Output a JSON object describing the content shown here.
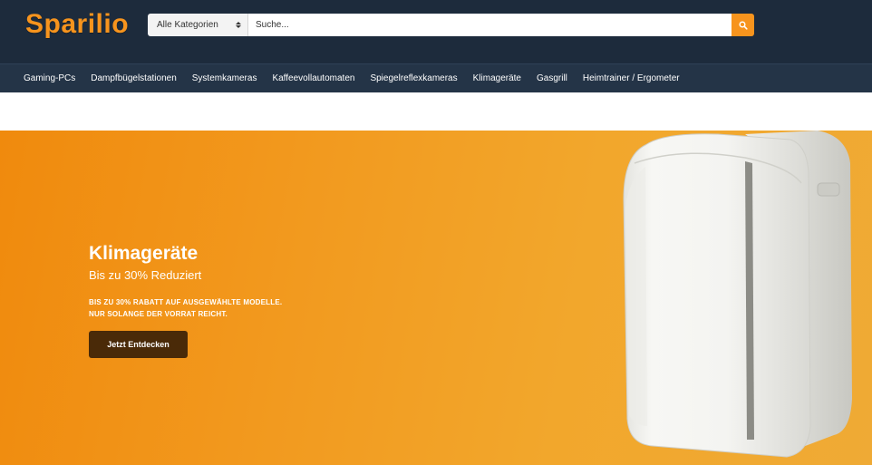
{
  "header": {
    "logo": "Sparilio",
    "category_select": "Alle Kategorien",
    "search_placeholder": "Suche...",
    "search_icon": "search-icon",
    "colors": {
      "background": "#1d2b3c",
      "accent": "#f7941d"
    }
  },
  "nav": {
    "items": [
      "Gaming-PCs",
      "Dampfbügelstationen",
      "Systemkameras",
      "Kaffeevollautomaten",
      "Spiegelreflexkameras",
      "Klimageräte",
      "Gasgrill",
      "Heimtrainer / Ergometer"
    ]
  },
  "hero": {
    "title": "Klimageräte",
    "subtitle": "Bis zu 30% Reduziert",
    "desc_line1": "BIS ZU 30% RABATT AUF AUSGEWÄHLTE MODELLE.",
    "desc_line2": "NUR SOLANGE DER VORRAT REICHT.",
    "button": "Jetzt Entdecken",
    "product_image": "portable-air-conditioner",
    "colors": {
      "gradient_start": "#f08a0d",
      "gradient_end": "#efaa35",
      "button": "#4a2a08"
    }
  }
}
